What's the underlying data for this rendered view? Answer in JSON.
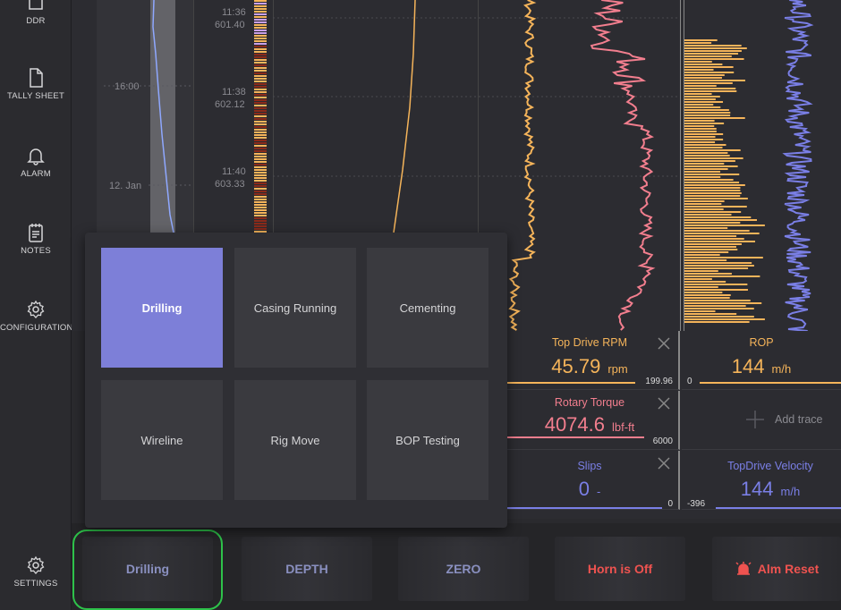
{
  "sidebar": {
    "items": [
      {
        "label": "DDR",
        "icon": "report-icon"
      },
      {
        "label": "TALLY SHEET",
        "icon": "document-icon"
      },
      {
        "label": "ALARM",
        "icon": "bell-icon"
      },
      {
        "label": "NOTES",
        "icon": "notes-icon"
      },
      {
        "label": "CONFIGURATION",
        "icon": "gear-icon"
      },
      {
        "label": "SETTINGS",
        "icon": "gear-icon"
      }
    ]
  },
  "chart": {
    "time_labels": [
      {
        "time": "11:36",
        "depth": "601.40"
      },
      {
        "time": "11:38",
        "depth": "602.12"
      },
      {
        "time": "11:40",
        "depth": "603.33"
      }
    ],
    "overview_labels": [
      "16:00",
      "12. Jan"
    ]
  },
  "readouts": [
    {
      "title": "Top Drive RPM",
      "value": "45.79",
      "unit": "rpm",
      "max": "199.96",
      "min": "",
      "color": "#f5b45a",
      "closable": true
    },
    {
      "title": "ROP",
      "value": "144",
      "unit": "m/h",
      "max": "",
      "min": "0",
      "color": "#f5b45a",
      "closable": false
    },
    {
      "title": "Rotary Torque",
      "value": "4074.6",
      "unit": "lbf-ft",
      "max": "6000",
      "min": "",
      "color": "#f27e8e",
      "closable": true
    },
    {
      "title": "Add trace",
      "value": "",
      "unit": "",
      "max": "",
      "min": "",
      "color": "#8a8a90",
      "closable": false
    },
    {
      "title": "Slips",
      "value": "0",
      "unit": "-",
      "max": "0",
      "min": "",
      "color": "#7a7fe6",
      "closable": true
    },
    {
      "title": "TopDrive Velocity",
      "value": "144",
      "unit": "m/h",
      "max": "",
      "min": "-396",
      "color": "#7a7fe6",
      "closable": false
    }
  ],
  "mode_popup": {
    "modes": [
      "Drilling",
      "Casing Running",
      "Cementing",
      "Wireline",
      "Rig Move",
      "BOP Testing"
    ],
    "selected": "Drilling"
  },
  "bottombar": {
    "mode_button": "Drilling",
    "depth_button": "DEPTH",
    "zero_button": "ZERO",
    "horn_button": "Horn is Off",
    "alarm_reset_button": "Alm Reset"
  },
  "colors": {
    "accent": "#7d7fd8",
    "orange": "#f5b45a",
    "pink": "#f27e8e",
    "blue": "#7a7fe6",
    "red": "#ef5350",
    "highlight": "#2ec24a"
  }
}
